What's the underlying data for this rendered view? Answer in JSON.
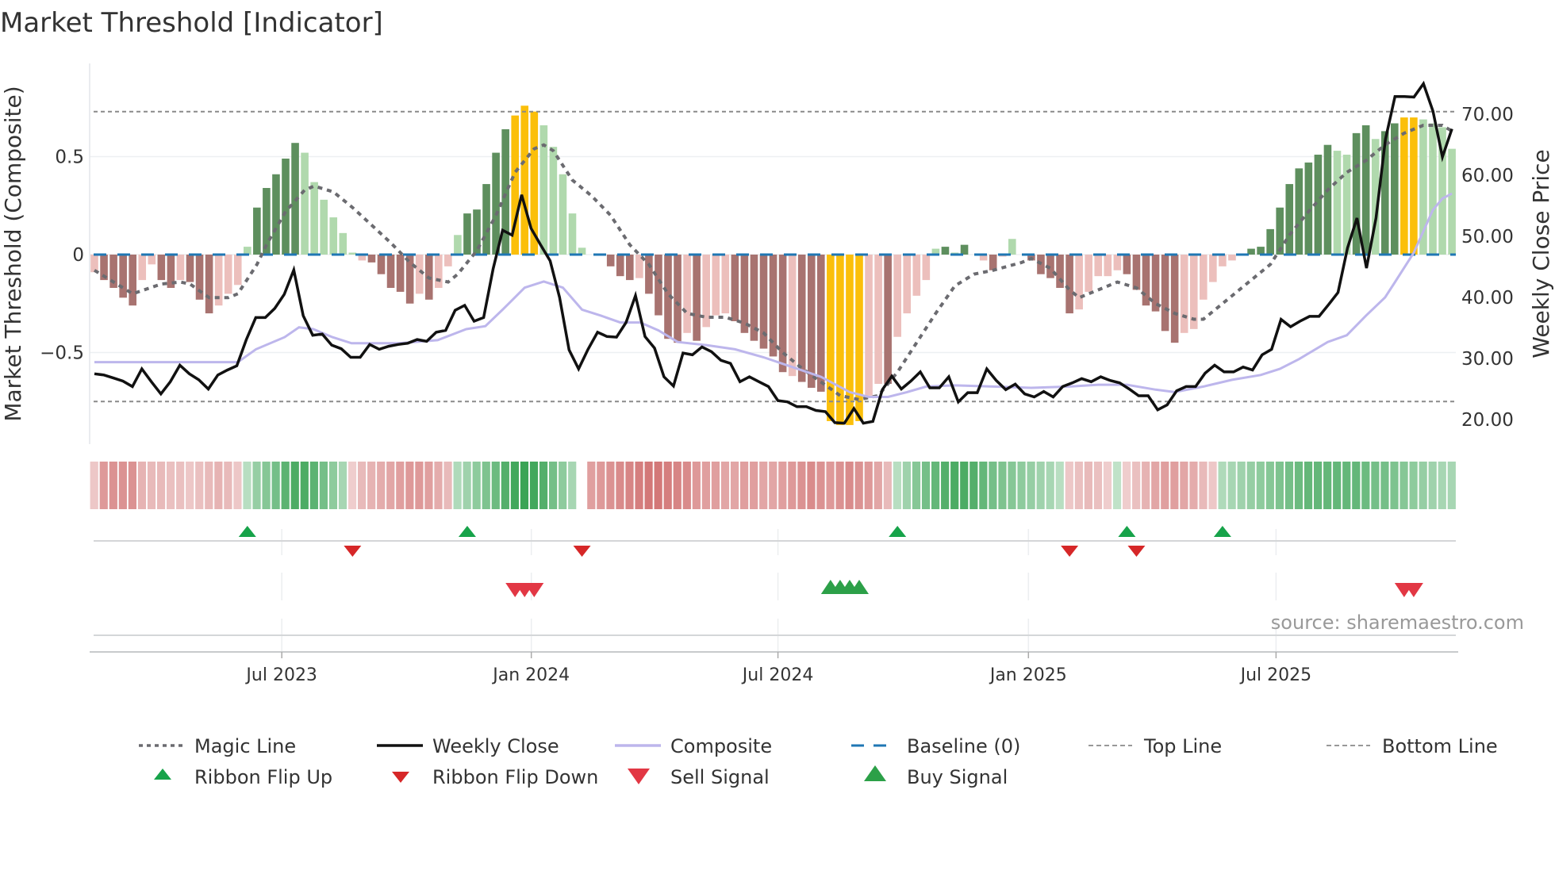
{
  "chart_data": {
    "type": "bar",
    "title": "Market Threshold [Indicator]",
    "ylabel": "Market Threshold (Composite)",
    "y2label": "Weekly Close Price",
    "source": "source: sharemaestro.com",
    "ylim": [
      -0.95,
      0.95
    ],
    "y2lim": [
      20,
      70
    ],
    "yticks": [
      {
        "v": 0.5,
        "label": "0.5"
      },
      {
        "v": 0,
        "label": "0"
      },
      {
        "v": -0.5,
        "label": "−0.5"
      }
    ],
    "y2ticks": [
      {
        "v": 70,
        "label": "70.00"
      },
      {
        "v": 60,
        "label": "60.00"
      },
      {
        "v": 50,
        "label": "50.00"
      },
      {
        "v": 40,
        "label": "40.00"
      },
      {
        "v": 30,
        "label": "30.00"
      },
      {
        "v": 20,
        "label": "20.00"
      }
    ],
    "xticks": [
      {
        "week": 19.6,
        "label": "Jul 2023"
      },
      {
        "week": 45.7,
        "label": "Jan 2024"
      },
      {
        "week": 71.5,
        "label": "Jul 2024"
      },
      {
        "week": 97.7,
        "label": "Jan 2025"
      },
      {
        "week": 123.6,
        "label": "Jul 2025"
      }
    ],
    "top_line": 0.73,
    "bottom_line": -0.75,
    "baseline": 0,
    "colors": {
      "up_strong": "#5e8f5e",
      "up_weak": "#b0d9ad",
      "down_strong": "#a87370",
      "down_weak": "#ecbfbc",
      "extreme": "#fbbf0a",
      "magic": "#6b6b70",
      "close": "#111111",
      "composite": "#bdb6ec",
      "baseline": "#1f77b4",
      "threshold": "#8a8a8a",
      "ribbon_pos": "#2e9e4a",
      "ribbon_neg": "#c95a5a",
      "flip_up": "#17a34a",
      "flip_down": "#d62728",
      "sell": "#e23744",
      "buy": "#2ca048"
    },
    "composite_bars": [
      -0.09,
      -0.13,
      -0.17,
      -0.22,
      -0.26,
      -0.13,
      -0.05,
      -0.13,
      -0.17,
      -0.13,
      -0.14,
      -0.23,
      -0.3,
      -0.26,
      -0.2,
      -0.155,
      0.04,
      0.24,
      0.34,
      0.41,
      0.49,
      0.57,
      0.52,
      0.37,
      0.28,
      0.19,
      0.11,
      0.01,
      -0.03,
      -0.04,
      -0.1,
      -0.17,
      -0.19,
      -0.25,
      -0.2,
      -0.23,
      -0.17,
      -0.06,
      0.1,
      0.21,
      0.23,
      0.36,
      0.52,
      0.64,
      0.71,
      0.76,
      0.73,
      0.66,
      0.55,
      0.41,
      0.21,
      0.035,
      0,
      0,
      -0.06,
      -0.11,
      -0.13,
      -0.12,
      -0.2,
      -0.31,
      -0.43,
      -0.45,
      -0.4,
      -0.44,
      -0.37,
      -0.31,
      -0.3,
      -0.34,
      -0.4,
      -0.44,
      -0.48,
      -0.52,
      -0.6,
      -0.62,
      -0.65,
      -0.68,
      -0.7,
      -0.85,
      -0.87,
      -0.87,
      -0.85,
      -0.72,
      -0.66,
      -0.66,
      -0.42,
      -0.3,
      -0.21,
      -0.13,
      0.03,
      0.04,
      0.01,
      0.05,
      0,
      -0.03,
      -0.08,
      -0.01,
      0.08,
      0,
      -0.03,
      -0.1,
      -0.12,
      -0.17,
      -0.3,
      -0.28,
      -0.19,
      -0.11,
      -0.11,
      -0.08,
      -0.1,
      -0.18,
      -0.26,
      -0.29,
      -0.39,
      -0.45,
      -0.4,
      -0.38,
      -0.23,
      -0.14,
      -0.06,
      -0.03,
      0,
      0.03,
      0.04,
      0.13,
      0.24,
      0.36,
      0.44,
      0.47,
      0.51,
      0.56,
      0.53,
      0.51,
      0.62,
      0.66,
      0.59,
      0.63,
      0.67,
      0.7,
      0.7,
      0.69,
      0.67,
      0.65,
      0.54
    ],
    "bar_states": "WSSSSWWSSWSSSWWWGDDDDDGGGGGGWSSSSSWSWWGDDDDDYYYGGGGGGGSSSWSSSSWSWWWSSSSSSWSSSYYYYWWSWWWWGDGDGWSWGGSSSSSWWWWWSSSSSSWWWWWWGDDDDDDDDDGGDDGDDYYGGGG",
    "bar_state_legend": {
      "D": "up_strong",
      "G": "up_weak",
      "S": "down_strong",
      "W": "down_weak",
      "Y": "extreme"
    },
    "weekly_close": [
      27.5,
      27.3,
      26.8,
      26.3,
      25.4,
      28.3,
      26.2,
      24.2,
      26.2,
      28.9,
      27.5,
      26.5,
      25,
      27.3,
      28.1,
      28.8,
      33.1,
      36.7,
      36.7,
      38.2,
      40.5,
      44.5,
      37,
      33.8,
      34,
      32.2,
      31.6,
      30.2,
      30.2,
      32.3,
      31.5,
      32,
      32.3,
      32.5,
      33.1,
      32.8,
      34.3,
      34.6,
      37.9,
      38.7,
      36.1,
      36.7,
      44.7,
      51,
      50.2,
      56.8,
      51.3,
      48.6,
      46,
      40,
      31.4,
      28.3,
      31.5,
      34.3,
      33.6,
      33.5,
      35.9,
      40.3,
      33.6,
      31.7,
      27,
      25.5,
      30.9,
      30.6,
      31.9,
      31.1,
      29.7,
      29.2,
      26.2,
      27,
      26.2,
      25.4,
      23.1,
      22.9,
      22.1,
      22.1,
      21.5,
      21.3,
      19.5,
      19.4,
      21.8,
      19.4,
      19.7,
      24.9,
      27.1,
      25,
      26.3,
      27.8,
      25.2,
      25.2,
      27,
      22.9,
      24.4,
      24.4,
      28.3,
      26.4,
      24.9,
      25.8,
      24.2,
      23.7,
      24.6,
      23.7,
      25.4,
      26,
      26.7,
      26.2,
      27,
      26.4,
      26,
      25,
      23.9,
      23.9,
      21.6,
      22.4,
      24.7,
      25.4,
      25.4,
      27.6,
      28.9,
      27.8,
      27.8,
      28.6,
      28.1,
      30.6,
      31.5,
      36.4,
      35.2,
      36.1,
      36.9,
      36.9,
      38.8,
      40.8,
      48.1,
      53,
      44.8,
      53,
      65.9,
      72.9,
      72.9,
      72.8,
      75,
      70.5,
      63,
      67.6
    ],
    "magic_line": [
      [
        0,
        -0.08
      ],
      [
        3,
        -0.17
      ],
      [
        4,
        -0.2
      ],
      [
        7,
        -0.15
      ],
      [
        9,
        -0.14
      ],
      [
        10,
        -0.15
      ],
      [
        12,
        -0.22
      ],
      [
        14,
        -0.22
      ],
      [
        15,
        -0.2
      ],
      [
        17,
        -0.05
      ],
      [
        18,
        0.05
      ],
      [
        20,
        0.22
      ],
      [
        22,
        0.33
      ],
      [
        23,
        0.35
      ],
      [
        25,
        0.32
      ],
      [
        27,
        0.24
      ],
      [
        29,
        0.15
      ],
      [
        31,
        0.06
      ],
      [
        33,
        -0.04
      ],
      [
        35,
        -0.12
      ],
      [
        37,
        -0.14
      ],
      [
        38,
        -0.1
      ],
      [
        40,
        0.02
      ],
      [
        42,
        0.2
      ],
      [
        44,
        0.42
      ],
      [
        46,
        0.54
      ],
      [
        47,
        0.56
      ],
      [
        48,
        0.53
      ],
      [
        50,
        0.38
      ],
      [
        52,
        0.3
      ],
      [
        54,
        0.2
      ],
      [
        56,
        0.05
      ],
      [
        58,
        -0.05
      ],
      [
        60,
        -0.2
      ],
      [
        62,
        -0.3
      ],
      [
        64,
        -0.32
      ],
      [
        66,
        -0.32
      ],
      [
        68,
        -0.35
      ],
      [
        70,
        -0.4
      ],
      [
        72,
        -0.5
      ],
      [
        74,
        -0.58
      ],
      [
        76,
        -0.65
      ],
      [
        78,
        -0.72
      ],
      [
        80,
        -0.74
      ],
      [
        82,
        -0.72
      ],
      [
        84,
        -0.6
      ],
      [
        86,
        -0.45
      ],
      [
        88,
        -0.3
      ],
      [
        90,
        -0.16
      ],
      [
        92,
        -0.1
      ],
      [
        94,
        -0.08
      ],
      [
        97,
        -0.04
      ],
      [
        98,
        -0.02
      ],
      [
        100,
        -0.07
      ],
      [
        102,
        -0.18
      ],
      [
        103,
        -0.22
      ],
      [
        105,
        -0.18
      ],
      [
        107,
        -0.14
      ],
      [
        109,
        -0.17
      ],
      [
        111,
        -0.25
      ],
      [
        113,
        -0.3
      ],
      [
        115,
        -0.33
      ],
      [
        116,
        -0.33
      ],
      [
        118,
        -0.25
      ],
      [
        121,
        -0.13
      ],
      [
        123,
        -0.05
      ],
      [
        125,
        0.1
      ],
      [
        127,
        0.22
      ],
      [
        129,
        0.33
      ],
      [
        131,
        0.42
      ],
      [
        133,
        0.48
      ],
      [
        135,
        0.56
      ],
      [
        137,
        0.62
      ],
      [
        139,
        0.66
      ],
      [
        141,
        0.66
      ],
      [
        142,
        0.63
      ]
    ],
    "composite_line": [
      [
        0,
        29.4
      ],
      [
        15,
        29.4
      ],
      [
        16.9,
        31.5
      ],
      [
        19.9,
        33.5
      ],
      [
        21.4,
        35.1
      ],
      [
        22.9,
        34.8
      ],
      [
        24.9,
        33.5
      ],
      [
        26.9,
        32.5
      ],
      [
        31.8,
        32.5
      ],
      [
        35.9,
        33
      ],
      [
        38.9,
        34.8
      ],
      [
        40.9,
        35.3
      ],
      [
        42.9,
        38.3
      ],
      [
        45,
        41.6
      ],
      [
        47,
        42.6
      ],
      [
        49,
        41.6
      ],
      [
        51,
        38
      ],
      [
        53,
        37
      ],
      [
        55,
        35.9
      ],
      [
        57.1,
        35.9
      ],
      [
        59,
        34.6
      ],
      [
        61,
        32.7
      ],
      [
        64,
        32.2
      ],
      [
        67,
        31.5
      ],
      [
        70,
        30.2
      ],
      [
        73,
        28.6
      ],
      [
        76,
        27
      ],
      [
        79,
        24.5
      ],
      [
        81,
        23.7
      ],
      [
        83,
        23.7
      ],
      [
        85,
        24.5
      ],
      [
        87,
        25.4
      ],
      [
        90,
        25.6
      ],
      [
        94,
        25.4
      ],
      [
        98,
        25.2
      ],
      [
        102,
        25.4
      ],
      [
        105,
        25.7
      ],
      [
        108,
        25.7
      ],
      [
        111,
        24.9
      ],
      [
        113,
        24.5
      ],
      [
        116,
        25.4
      ],
      [
        119,
        26.5
      ],
      [
        122,
        27.3
      ],
      [
        124,
        28.3
      ],
      [
        126,
        29.9
      ],
      [
        129,
        32.7
      ],
      [
        131,
        33.8
      ],
      [
        133,
        37
      ],
      [
        135,
        40
      ],
      [
        136,
        42.4
      ],
      [
        138,
        47.3
      ],
      [
        140,
        54.3
      ],
      [
        141,
        56.2
      ],
      [
        142,
        57
      ]
    ],
    "ribbon": [
      -0.2,
      -0.55,
      -0.6,
      -0.6,
      -0.6,
      -0.35,
      -0.3,
      -0.3,
      -0.25,
      -0.25,
      -0.2,
      -0.25,
      -0.3,
      -0.35,
      -0.3,
      -0.2,
      0.2,
      0.4,
      0.5,
      0.6,
      0.75,
      0.85,
      0.85,
      0.75,
      0.6,
      0.45,
      0.3,
      -0.15,
      -0.3,
      -0.35,
      -0.4,
      -0.45,
      -0.5,
      -0.55,
      -0.55,
      -0.5,
      -0.4,
      -0.3,
      0.25,
      0.35,
      0.45,
      0.55,
      0.65,
      0.8,
      0.9,
      0.95,
      0.9,
      0.8,
      0.6,
      0.45,
      0.3,
      null,
      -0.5,
      -0.55,
      -0.6,
      -0.65,
      -0.7,
      -0.75,
      -0.8,
      -0.8,
      -0.75,
      -0.7,
      -0.65,
      -0.55,
      -0.5,
      -0.5,
      -0.45,
      -0.45,
      -0.5,
      -0.5,
      -0.45,
      -0.45,
      -0.5,
      -0.55,
      -0.6,
      -0.65,
      -0.6,
      -0.55,
      -0.6,
      -0.65,
      -0.6,
      -0.55,
      -0.45,
      -0.3,
      0.2,
      0.35,
      0.5,
      0.6,
      0.7,
      0.8,
      0.85,
      0.85,
      0.8,
      0.7,
      0.6,
      0.55,
      0.5,
      0.45,
      0.4,
      0.35,
      0.3,
      0.2,
      -0.2,
      -0.25,
      -0.3,
      -0.25,
      -0.15,
      0.15,
      -0.15,
      -0.25,
      -0.35,
      -0.45,
      -0.5,
      -0.5,
      -0.45,
      -0.4,
      -0.3,
      -0.2,
      0.25,
      0.3,
      0.35,
      0.4,
      0.45,
      0.5,
      0.55,
      0.6,
      0.65,
      0.7,
      0.7,
      0.7,
      0.7,
      0.7,
      0.7,
      0.65,
      0.6,
      0.6,
      0.55,
      0.5,
      0.45,
      0.4,
      0.35,
      0.3,
      0.3
    ],
    "ribbon_flip_up": [
      16,
      39,
      84,
      108,
      118
    ],
    "ribbon_flip_down": [
      27,
      51,
      102,
      109
    ],
    "sell_signals": [
      44,
      45,
      46,
      137,
      138
    ],
    "buy_signals": [
      77,
      78,
      79,
      80
    ],
    "legend": [
      {
        "key": "magic",
        "label": "Magic Line",
        "style": "dotted"
      },
      {
        "key": "close",
        "label": "Weekly Close",
        "style": "solid"
      },
      {
        "key": "composite",
        "label": "Composite",
        "style": "solid"
      },
      {
        "key": "baseline",
        "label": "Baseline (0)",
        "style": "dashed"
      },
      {
        "key": "top",
        "label": "Top Line",
        "style": "thin-dashed"
      },
      {
        "key": "bottom",
        "label": "Bottom Line",
        "style": "thin-dashed"
      },
      {
        "key": "flip_up",
        "label": "Ribbon Flip Up",
        "style": "marker-up"
      },
      {
        "key": "flip_down",
        "label": "Ribbon Flip Down",
        "style": "marker-down"
      },
      {
        "key": "sell",
        "label": "Sell Signal",
        "style": "big-down"
      },
      {
        "key": "buy",
        "label": "Buy Signal",
        "style": "big-up"
      }
    ],
    "legend_placement": "bottom"
  }
}
